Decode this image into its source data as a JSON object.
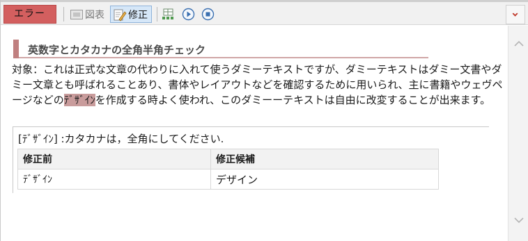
{
  "toolbar": {
    "error_tab": "エラー",
    "figure_label": "図表",
    "edit_label": "修正",
    "icons": [
      "figure-icon",
      "edit-icon",
      "grid-icon",
      "play-icon",
      "stop-icon",
      "chevron-down-icon"
    ]
  },
  "section": {
    "title": "英数字とカタカナの全角半角チェック"
  },
  "target": {
    "before": "対象：これは正式な文章の代わりに入れて使うダミーテキストですが、ダミーテキストはダミー文書やダミー文章とも呼ばれることあり、書体やレイアウトなどを確認するために用いられ、主に書籍やウェヴページなどの",
    "highlight": "ﾃﾞｻﾞｲﾝ",
    "after": "を作成する時よく使われ、このダミーーテキストは自由に改変することが出来ます。"
  },
  "detail": {
    "message": "[ﾃﾞｻﾞｲﾝ] :カタカナは，全角にしてください.",
    "table": {
      "headers": [
        "修正前",
        "修正候補"
      ],
      "rows": [
        [
          "ﾃﾞｻﾞｲﾝ",
          "デザイン"
        ]
      ]
    }
  },
  "colors": {
    "error_tab": "#d35f5f",
    "highlight": "#c99c9c",
    "section_bar": "#c08080",
    "active_button": "#d6e7f8",
    "dropdown_chevron": "#c0392b"
  }
}
